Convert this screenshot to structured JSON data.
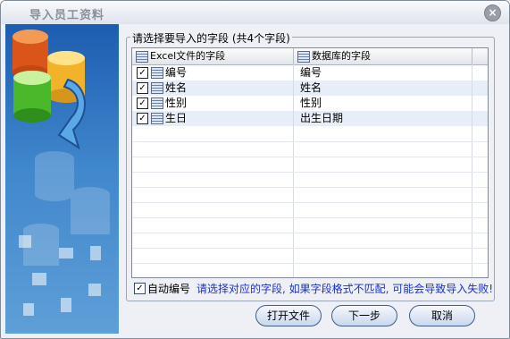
{
  "window": {
    "title": "导入员工资料",
    "close_glyph": "×"
  },
  "group": {
    "legend": "请选择要导入的字段 (共4个字段)"
  },
  "table": {
    "columns": [
      "Excel文件的字段",
      "数据库的字段"
    ],
    "rows": [
      {
        "checked": true,
        "excel": "编号",
        "db": "编号"
      },
      {
        "checked": true,
        "excel": "姓名",
        "db": "姓名"
      },
      {
        "checked": true,
        "excel": "性别",
        "db": "性别"
      },
      {
        "checked": true,
        "excel": "生日",
        "db": "出生日期"
      }
    ]
  },
  "options": {
    "auto_number_label": "自动编号",
    "auto_number_checked": true,
    "check_glyph": "✓"
  },
  "warning": "请选择对应的字段, 如果字段格式不匹配, 可能会导致导入失败!",
  "buttons": {
    "open": "打开文件",
    "next": "下一步",
    "cancel": "取消"
  },
  "colors": {
    "warning_text": "#1a32c8",
    "side_panel": "#3f86cc",
    "row_alt": "#e7eef8"
  }
}
